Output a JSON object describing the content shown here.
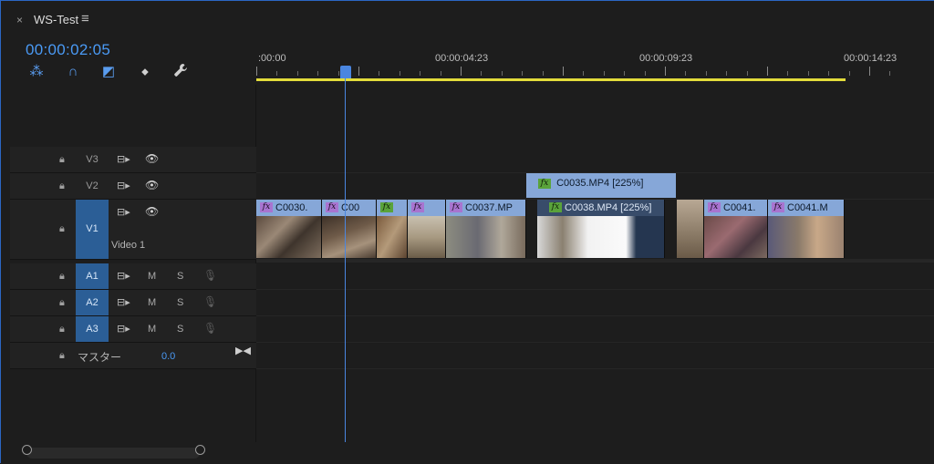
{
  "tab": {
    "title": "WS-Test",
    "close": "×",
    "menu": "≡"
  },
  "timecode": "00:00:02:05",
  "tools": [
    {
      "name": "nest-sequence-icon",
      "glyph": "⁂"
    },
    {
      "name": "snap-magnet-icon",
      "glyph": "∩"
    },
    {
      "name": "linked-selection-icon",
      "glyph": "◩"
    },
    {
      "name": "add-marker-icon",
      "glyph": "⬥"
    },
    {
      "name": "wrench-icon",
      "glyph": "🔧"
    }
  ],
  "ruler": {
    "labels": [
      ":00:00",
      "00:00:04:23",
      "00:00:09:23",
      "00:00:14:23"
    ]
  },
  "tracks": {
    "v3": {
      "name": "V3"
    },
    "v2": {
      "name": "V2"
    },
    "v1": {
      "name": "V1",
      "label": "Video 1"
    },
    "a1": {
      "name": "A1",
      "m": "M",
      "s": "S"
    },
    "a2": {
      "name": "A2",
      "m": "M",
      "s": "S"
    },
    "a3": {
      "name": "A3",
      "m": "M",
      "s": "S"
    },
    "master": {
      "label": "マスター",
      "value": "0.0"
    }
  },
  "clips_v1": [
    {
      "name": "C0030.",
      "fx": "fx",
      "fx_color": "#a874d0"
    },
    {
      "name": "C00",
      "fx": "fx",
      "fx_color": "#a874d0"
    },
    {
      "name": "",
      "fx": "fx",
      "fx_color": "#5aa33b"
    },
    {
      "name": "",
      "fx": "fx",
      "fx_color": "#a874d0"
    },
    {
      "name": "C0037.MP",
      "fx": "fx",
      "fx_color": "#a874d0"
    },
    {
      "name": "C0038.MP4 [225%]",
      "fx": "fx",
      "fx_color": "#5aa33b"
    },
    {
      "name": "",
      "fx": "",
      "fx_color": ""
    },
    {
      "name": "C0041.",
      "fx": "fx",
      "fx_color": "#a874d0"
    },
    {
      "name": "C0041.M",
      "fx": "fx",
      "fx_color": "#a874d0"
    }
  ],
  "clip_v2": {
    "name": "C0035.MP4 [225%]",
    "fx": "fx"
  },
  "colors": {
    "accent": "#4a9af5",
    "work_area": "#e2dc3b",
    "clip": "#86a7d8",
    "track_active": "#2b5e96"
  }
}
